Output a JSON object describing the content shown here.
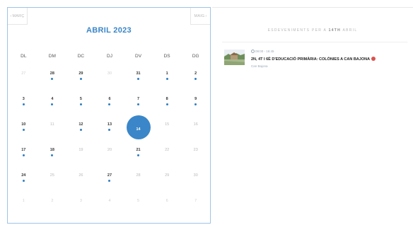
{
  "nav": {
    "prev_label": "Març",
    "next_label": "Maig"
  },
  "calendar": {
    "month_title": "ABRIL 2023",
    "weekdays": [
      "DL",
      "DM",
      "DC",
      "DJ",
      "DV",
      "DS",
      "DG"
    ],
    "weeks": [
      [
        {
          "day": "27",
          "state": "other",
          "event": false
        },
        {
          "day": "28",
          "state": "current",
          "event": true
        },
        {
          "day": "29",
          "state": "current",
          "event": true
        },
        {
          "day": "30",
          "state": "other",
          "event": false
        },
        {
          "day": "31",
          "state": "current",
          "event": true
        },
        {
          "day": "1",
          "state": "current",
          "event": true
        },
        {
          "day": "2",
          "state": "current",
          "event": true
        }
      ],
      [
        {
          "day": "3",
          "state": "current",
          "event": true
        },
        {
          "day": "4",
          "state": "current",
          "event": true
        },
        {
          "day": "5",
          "state": "current",
          "event": true
        },
        {
          "day": "6",
          "state": "current",
          "event": true
        },
        {
          "day": "7",
          "state": "current",
          "event": true
        },
        {
          "day": "8",
          "state": "current",
          "event": true
        },
        {
          "day": "9",
          "state": "current",
          "event": true
        }
      ],
      [
        {
          "day": "10",
          "state": "current",
          "event": true
        },
        {
          "day": "11",
          "state": "current",
          "event": false
        },
        {
          "day": "12",
          "state": "current",
          "event": true
        },
        {
          "day": "13",
          "state": "current",
          "event": true
        },
        {
          "day": "14",
          "state": "selected",
          "event": false
        },
        {
          "day": "15",
          "state": "current",
          "event": false
        },
        {
          "day": "16",
          "state": "current",
          "event": false
        }
      ],
      [
        {
          "day": "17",
          "state": "current",
          "event": true
        },
        {
          "day": "18",
          "state": "current",
          "event": true
        },
        {
          "day": "19",
          "state": "current",
          "event": false
        },
        {
          "day": "20",
          "state": "current",
          "event": false
        },
        {
          "day": "21",
          "state": "current",
          "event": true
        },
        {
          "day": "22",
          "state": "current",
          "event": false
        },
        {
          "day": "23",
          "state": "current",
          "event": false
        }
      ],
      [
        {
          "day": "24",
          "state": "current",
          "event": true
        },
        {
          "day": "25",
          "state": "current",
          "event": false
        },
        {
          "day": "26",
          "state": "current",
          "event": false
        },
        {
          "day": "27",
          "state": "current",
          "event": true
        },
        {
          "day": "28",
          "state": "current",
          "event": false
        },
        {
          "day": "29",
          "state": "current",
          "event": false
        },
        {
          "day": "30",
          "state": "current",
          "event": false
        }
      ],
      [
        {
          "day": "1",
          "state": "other",
          "event": false
        },
        {
          "day": "2",
          "state": "other",
          "event": false
        },
        {
          "day": "3",
          "state": "other",
          "event": false
        },
        {
          "day": "4",
          "state": "other",
          "event": false
        },
        {
          "day": "5",
          "state": "other",
          "event": false
        },
        {
          "day": "6",
          "state": "other",
          "event": false
        },
        {
          "day": "7",
          "state": "other",
          "event": false
        }
      ]
    ]
  },
  "events_panel": {
    "header_prefix": "Esdeveniments per a",
    "header_date": "14th",
    "header_suffix": "abril",
    "items": [
      {
        "time": "09:00 - 16:45",
        "title": "2N, 4T I 6È D'EDUCACIÓ PRIMÀRIA: COLÒNIES A CAN BAJONA",
        "location": "Can Bajona",
        "status_color": "#d9534f"
      }
    ]
  },
  "colors": {
    "accent": "#3a86c8",
    "dot": "#2f7fc1",
    "border": "#9dc3e6"
  },
  "icons": {
    "prev": "chevron-left-icon",
    "next": "chevron-right-icon",
    "time": "clock-icon"
  }
}
